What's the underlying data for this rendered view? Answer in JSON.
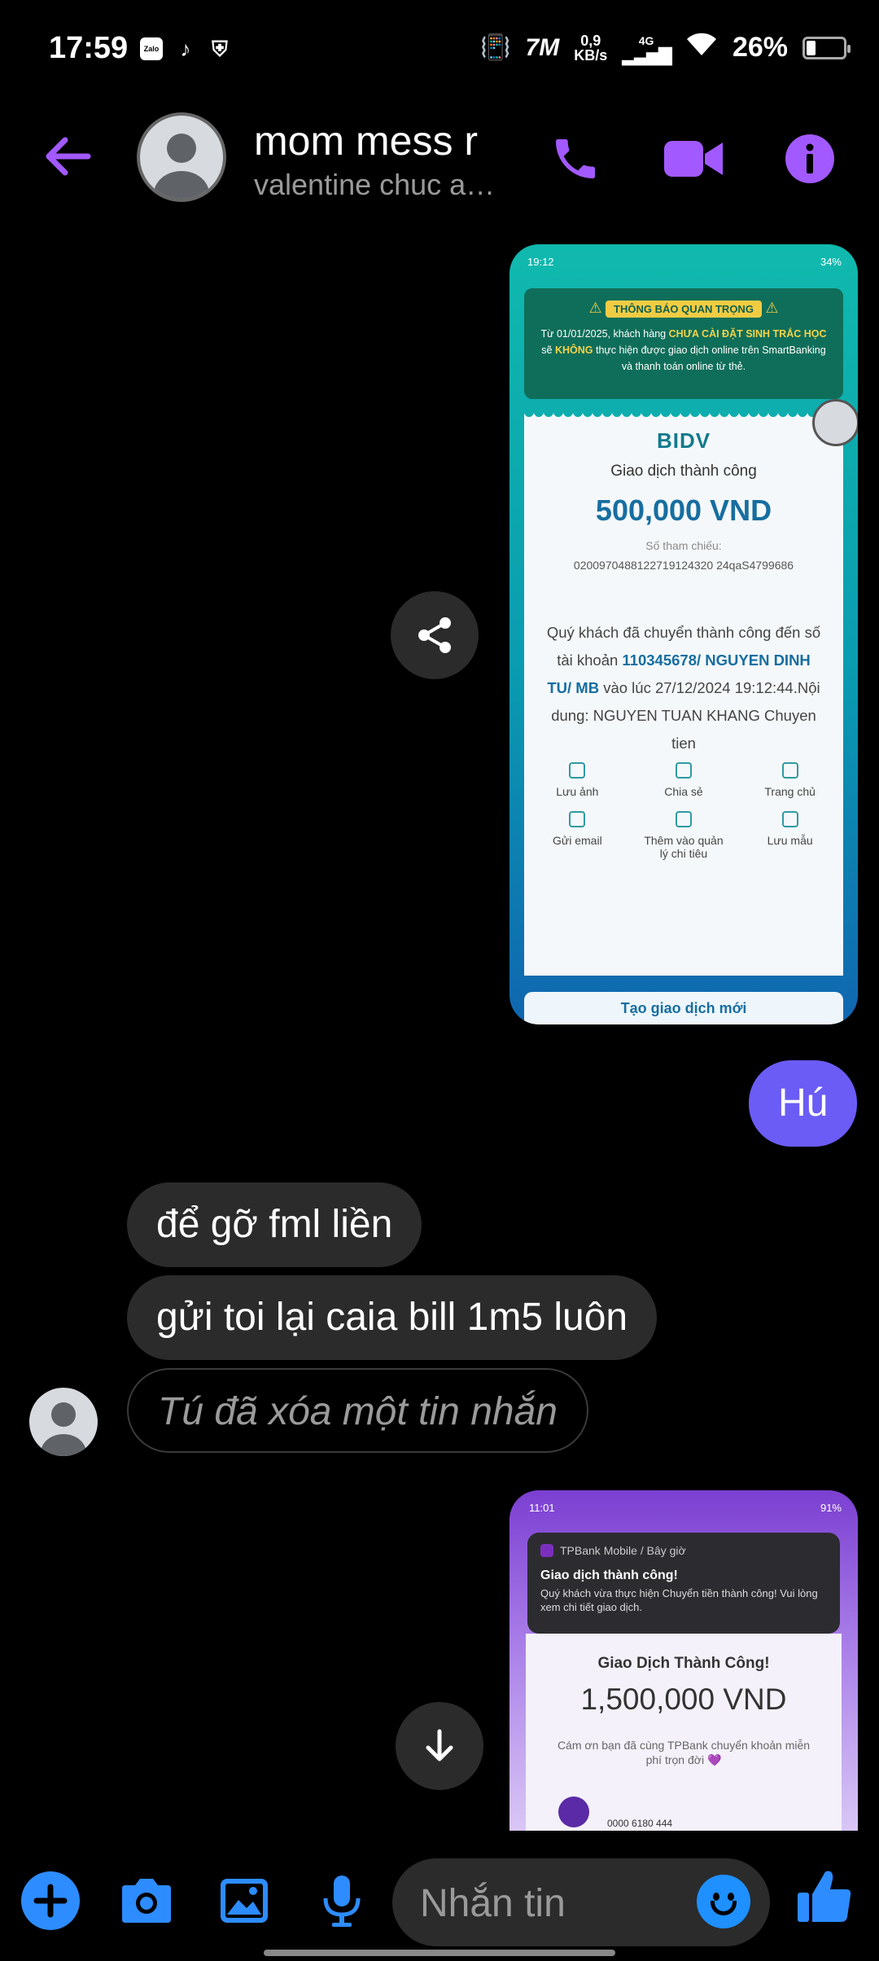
{
  "status_bar": {
    "time": "17:59",
    "app_icons": [
      "Zalo",
      "TikTok",
      "shield"
    ],
    "net_speed": "0,9",
    "net_unit": "KB/s",
    "net_type": "4G",
    "battery": "26%",
    "battery_level": 0.26
  },
  "header": {
    "name": "mom mess r",
    "subtitle": "valentine chuc a…",
    "accent_color": "#a259ff"
  },
  "messages": {
    "shot1": {
      "status_time": "19:12",
      "status_right": "34%",
      "notice_title": "THÔNG BÁO QUAN TRỌNG",
      "notice_line1_a": "Từ 01/01/2025, khách hàng ",
      "notice_line1_hl": "CHƯA CÀI ĐẶT SINH TRẮC HỌC",
      "notice_line2_a": "sẽ ",
      "notice_line2_hl": "KHÔNG",
      "notice_line2_b": " thực hiện được giao dịch online trên SmartBanking",
      "notice_line3": "và thanh toán online từ thẻ.",
      "bank": "BIDV",
      "success": "Giao dịch thành công",
      "amount": "500,000 VND",
      "ref_label": "Số tham chiếu:",
      "ref": "0200970488122719124320 24qaS4799686",
      "desc_a": "Quý khách đã chuyển thành công đến số tài khoản ",
      "desc_acc": "110345678/ NGUYEN DINH TU/ MB",
      "desc_b": " vào lúc 27/12/2024 19:12:44.Nội dung: NGUYEN TUAN KHANG Chuyen tien",
      "actions_row1": [
        "Lưu ảnh",
        "Chia sẻ",
        "Trang chủ"
      ],
      "actions_row2": [
        "Gửi email",
        "Thêm vào quản lý chi tiêu",
        "Lưu mẫu"
      ],
      "new_tx": "Tạo giao dịch mới"
    },
    "sent_hu": "Hú",
    "recv1": "để gỡ fml liền",
    "recv2": "gửi toi lại caia bill 1m5 luôn",
    "deleted": "Tú đã xóa một tin nhắn",
    "shot2": {
      "status_time": "11:01",
      "status_right": "91%",
      "notif_app": "TPBank Mobile / Bây giờ",
      "notif_title": "Giao dịch thành công!",
      "notif_body": "Quý khách vừa thực hiện Chuyển tiền thành công! Vui lòng xem chi tiết giao dịch.",
      "title": "Giao Dịch Thành Công!",
      "amount": "1,500,000 VND",
      "thanks": "Cám ơn bạn đã cùng TPBank chuyển khoản miễn phí trọn đời 💜",
      "account": "0000 6180 444"
    }
  },
  "composer": {
    "placeholder": "Nhắn tin",
    "icon_color": "#2d8cff"
  }
}
